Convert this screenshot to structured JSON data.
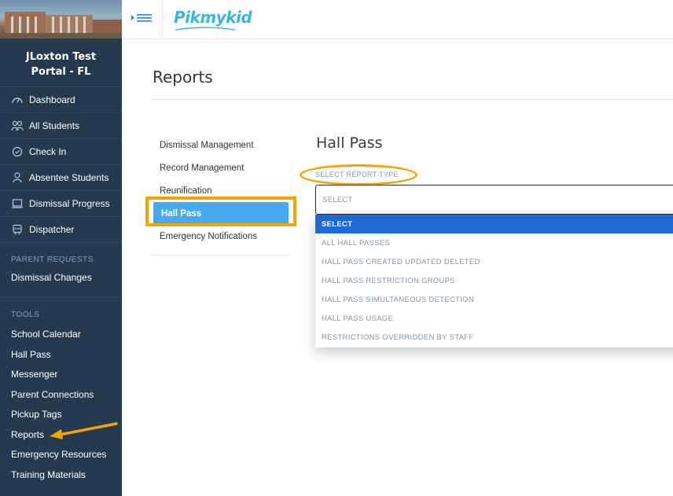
{
  "sidebar": {
    "portal_title": "JLoxton Test Portal - FL",
    "nav": [
      {
        "label": "Dashboard",
        "icon": "gauge-icon"
      },
      {
        "label": "All Students",
        "icon": "students-icon"
      },
      {
        "label": "Check In",
        "icon": "check-circle-icon"
      },
      {
        "label": "Absentee Students",
        "icon": "absentee-icon"
      },
      {
        "label": "Dismissal Progress",
        "icon": "laptop-icon"
      },
      {
        "label": "Dispatcher",
        "icon": "bus-icon"
      }
    ],
    "parent_requests": {
      "heading": "PARENT REQUESTS",
      "items": [
        "Dismissal Changes"
      ]
    },
    "tools": {
      "heading": "TOOLS",
      "items": [
        "School Calendar",
        "Hall Pass",
        "Messenger",
        "Parent Connections",
        "Pickup Tags",
        "Reports",
        "Emergency Resources",
        "Training Materials"
      ]
    }
  },
  "topbar": {
    "logo": "Pikmykid",
    "menu_icon": "menu-toggle-icon"
  },
  "page": {
    "title": "Reports",
    "report_nav": [
      "Dismissal Management",
      "Record Management",
      "Reunification",
      "Hall Pass",
      "Emergency Notifications"
    ],
    "active_report": "Hall Pass",
    "section_title": "Hall Pass",
    "report_type_label": "SELECT REPORT TYPE",
    "select_value": "SELECT",
    "options": [
      "SELECT",
      "ALL HALL PASSES",
      "HALL PASS CREATED UPDATED DELETED",
      "HALL PASS RESTRICTION GROUPS",
      "HALL PASS SIMULTANEOUS DETECTION",
      "HALL PASS USAGE",
      "RESTRICTIONS OVERRIDDEN BY STAFF"
    ]
  },
  "colors": {
    "sidebar_bg": "#253a4f",
    "accent_blue": "#47aaf0",
    "selected_option": "#1d69d3",
    "annotation_orange": "#f5a300",
    "logo_blue": "#3bb3e6"
  }
}
